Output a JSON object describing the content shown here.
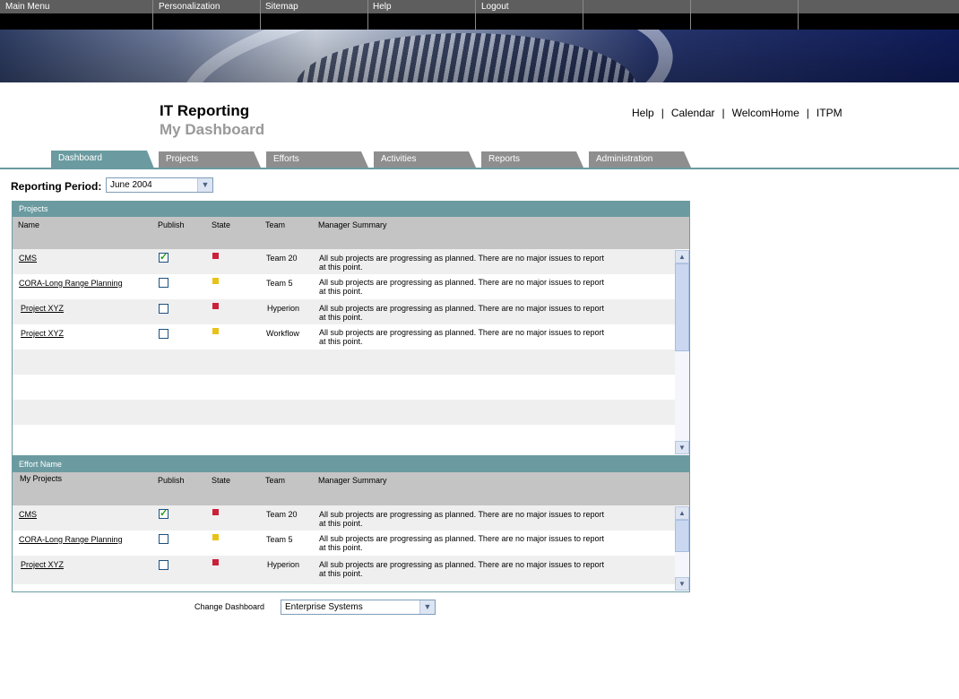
{
  "topnav": {
    "items": [
      "Main Menu",
      "Personalization",
      "Sitemap",
      "Help",
      "Logout"
    ]
  },
  "header": {
    "title": "IT Reporting",
    "subtitle": "My Dashboard",
    "links": [
      "Help",
      "Calendar",
      "WelcomHome",
      "ITPM"
    ],
    "separator": "|"
  },
  "tabs": [
    "Dashboard",
    "Projects",
    "Efforts",
    "Activities",
    "Reports",
    "Administration"
  ],
  "period": {
    "label": "Reporting Period:",
    "value": "June 2004"
  },
  "projects_panel": {
    "title": "Projects",
    "columns": [
      "Name",
      "Publish",
      "State",
      "Team",
      "Manager Summary"
    ],
    "rows": [
      {
        "name": "CMS",
        "publish": true,
        "state": "#cc1f3a",
        "team": "Team 20",
        "summary_1": "All sub projects are progressing as planned. There are no major issues to report",
        "summary_2": "at this point."
      },
      {
        "name": "CORA-Long Range Planning",
        "publish": false,
        "state": "#e8c21a",
        "team": "Team 5",
        "summary_1": "All sub projects are progressing as planned. There are no major issues to report",
        "summary_2": "at this point."
      },
      {
        "name": "Project XYZ",
        "publish": false,
        "state": "#cc1f3a",
        "team": "Hyperion",
        "summary_1": "All sub projects are progressing as planned. There are no major issues to report",
        "summary_2": "at this point."
      },
      {
        "name": "Project XYZ",
        "publish": false,
        "state": "#e8c21a",
        "team": "Workflow",
        "summary_1": "All sub projects are progressing as planned. There are no major issues to report",
        "summary_2": "at this point."
      }
    ]
  },
  "efforts_panel": {
    "title": "Effort Name",
    "first_column": "My Projects",
    "columns": [
      "Publish",
      "State",
      "Team",
      "Manager Summary"
    ],
    "rows": [
      {
        "name": "CMS",
        "publish": true,
        "state": "#cc1f3a",
        "team": "Team 20",
        "summary_1": "All sub projects are progressing as planned. There are no major issues to report",
        "summary_2": "at this point."
      },
      {
        "name": "CORA-Long Range Planning",
        "publish": false,
        "state": "#e8c21a",
        "team": "Team 5",
        "summary_1": "All sub projects are progressing as planned. There are no major issues to report",
        "summary_2": "at this point."
      },
      {
        "name": "Project XYZ",
        "publish": false,
        "state": "#cc1f3a",
        "team": "Hyperion",
        "summary_1": "All sub projects are progressing as planned. There are no major issues to report",
        "summary_2": "at this point."
      }
    ]
  },
  "change_dashboard": {
    "label": "Change Dashboard",
    "value": "Enterprise Systems"
  },
  "colors": {
    "accent": "#6b9ba0",
    "tab_inactive": "#8e8e8e",
    "state_red": "#cc1f3a",
    "state_yellow": "#e8c21a"
  }
}
